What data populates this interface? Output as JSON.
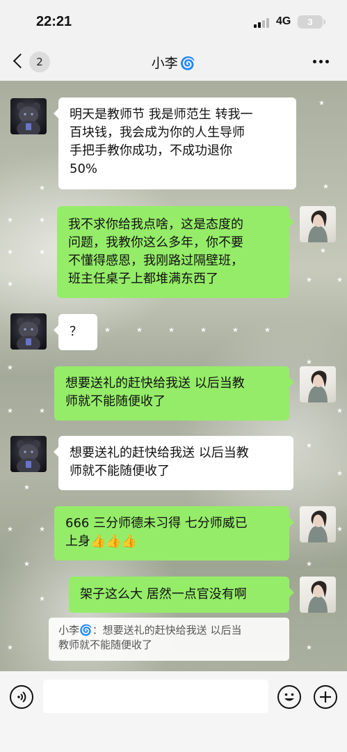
{
  "status_bar": {
    "time": "22:21",
    "network": "4G",
    "battery": "3"
  },
  "header": {
    "unread_count": "2",
    "title": "小李",
    "title_icon": "swirl-emoji"
  },
  "messages": [
    {
      "side": "incoming",
      "lines": [
        "明天是教师节 我是师范生 转我一",
        "百块钱，我会成为你的人生导师",
        "手把手教你成功，不成功退你",
        "50%"
      ]
    },
    {
      "side": "outgoing",
      "lines": [
        "我不求你给我点啥，这是态度的",
        "问题，我教你这么多年，你不要",
        "不懂得感恩，我刚路过隔壁班，",
        "班主任桌子上都堆满东西了"
      ]
    },
    {
      "side": "incoming",
      "lines": [
        "？"
      ]
    },
    {
      "side": "outgoing",
      "lines": [
        "想要送礼的赶快给我送 以后当教",
        "师就不能随便收了"
      ]
    },
    {
      "side": "incoming",
      "lines": [
        "想要送礼的赶快给我送 以后当教",
        "师就不能随便收了"
      ]
    },
    {
      "side": "outgoing",
      "lines": [
        "666 三分师德未习得 七分师威已",
        "上身👍👍👍"
      ]
    },
    {
      "side": "outgoing",
      "lines": [
        "架子这么大 居然一点官没有啊"
      ]
    }
  ],
  "quote": {
    "lines": [
      "小李🌀：想要送礼的赶快给我送 以后当",
      "教师就不能随便收了"
    ]
  },
  "colors": {
    "outgoing_bubble": "#95ec69",
    "incoming_bubble": "#ffffff",
    "bar_background": "#f2f2f2"
  },
  "icons": {
    "voice": "voice-icon",
    "emoji": "emoji-icon",
    "plus": "plus-icon",
    "back": "back-chevron-icon",
    "more": "more-icon"
  }
}
